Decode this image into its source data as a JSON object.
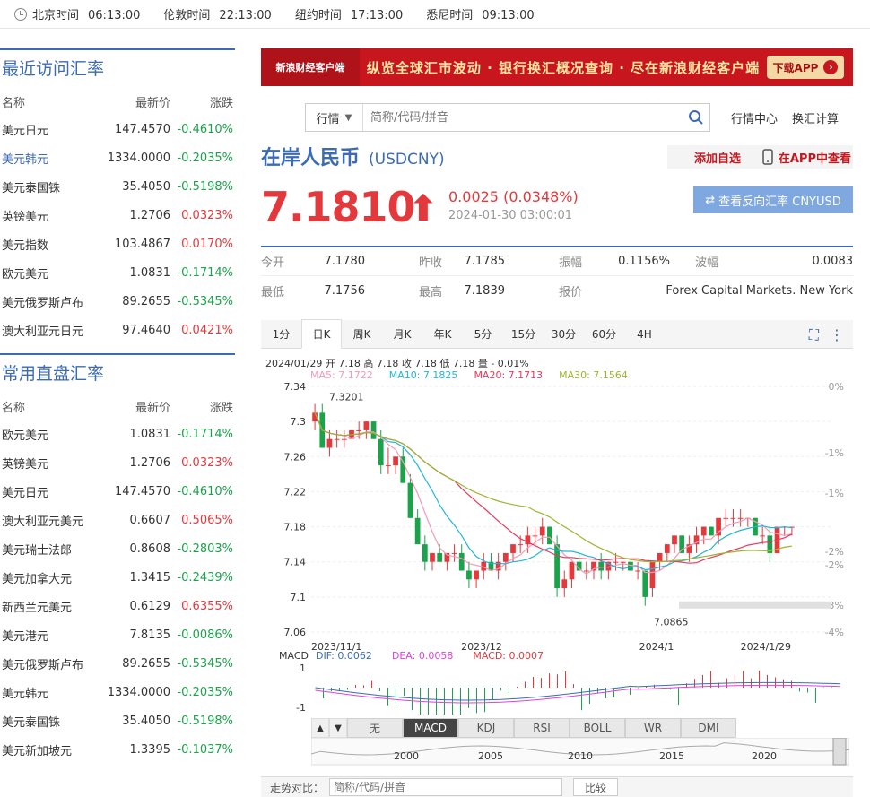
{
  "world_clock": [
    {
      "city": "北京时间",
      "time": "06:13:00"
    },
    {
      "city": "伦敦时间",
      "time": "22:13:00"
    },
    {
      "city": "纽约时间",
      "time": "17:13:00"
    },
    {
      "city": "悉尼时间",
      "time": "09:13:00"
    }
  ],
  "recent": {
    "title": "最近访问汇率",
    "headers": [
      "名称",
      "最新价",
      "涨跌"
    ],
    "rows": [
      {
        "name": "美元日元",
        "price": "147.4570",
        "chg": "-0.4610%",
        "dir": "dn"
      },
      {
        "name": "美元韩元",
        "price": "1334.0000",
        "chg": "-0.2035%",
        "dir": "dn",
        "link": true
      },
      {
        "name": "美元泰国铢",
        "price": "35.4050",
        "chg": "-0.5198%",
        "dir": "dn"
      },
      {
        "name": "英镑美元",
        "price": "1.2706",
        "chg": "0.0323%",
        "dir": "up"
      },
      {
        "name": "美元指数",
        "price": "103.4867",
        "chg": "0.0170%",
        "dir": "up"
      },
      {
        "name": "欧元美元",
        "price": "1.0831",
        "chg": "-0.1714%",
        "dir": "dn"
      },
      {
        "name": "美元俄罗斯卢布",
        "price": "89.2655",
        "chg": "-0.5345%",
        "dir": "dn"
      },
      {
        "name": "澳大利亚元日元",
        "price": "97.4640",
        "chg": "0.0421%",
        "dir": "up"
      }
    ]
  },
  "common": {
    "title": "常用直盘汇率",
    "headers": [
      "名称",
      "最新价",
      "涨跌"
    ],
    "rows": [
      {
        "name": "欧元美元",
        "price": "1.0831",
        "chg": "-0.1714%",
        "dir": "dn"
      },
      {
        "name": "英镑美元",
        "price": "1.2706",
        "chg": "0.0323%",
        "dir": "up"
      },
      {
        "name": "美元日元",
        "price": "147.4570",
        "chg": "-0.4610%",
        "dir": "dn"
      },
      {
        "name": "澳大利亚元美元",
        "price": "0.6607",
        "chg": "0.5065%",
        "dir": "up"
      },
      {
        "name": "美元瑞士法郎",
        "price": "0.8608",
        "chg": "-0.2803%",
        "dir": "dn"
      },
      {
        "name": "美元加拿大元",
        "price": "1.3415",
        "chg": "-0.2439%",
        "dir": "dn"
      },
      {
        "name": "新西兰元美元",
        "price": "0.6129",
        "chg": "0.6355%",
        "dir": "up"
      },
      {
        "name": "美元港元",
        "price": "7.8135",
        "chg": "-0.0086%",
        "dir": "dn"
      },
      {
        "name": "美元俄罗斯卢布",
        "price": "89.2655",
        "chg": "-0.5345%",
        "dir": "dn"
      },
      {
        "name": "美元韩元",
        "price": "1334.0000",
        "chg": "-0.2035%",
        "dir": "dn"
      },
      {
        "name": "美元泰国铢",
        "price": "35.4050",
        "chg": "-0.5198%",
        "dir": "dn"
      },
      {
        "name": "美元新加坡元",
        "price": "1.3395",
        "chg": "-0.1037%",
        "dir": "dn"
      }
    ]
  },
  "banner": {
    "logo": "新浪财经客户端",
    "slogan": "纵览全球汇市波动 · 银行换汇概况查询 · 尽在新浪财经客户端",
    "download": "下载APP"
  },
  "search": {
    "select": "行情",
    "placeholder": "简称/代码/拼音"
  },
  "toplinks": [
    "行情中心",
    "换汇计算"
  ],
  "header": {
    "name": "在岸人民币",
    "code": "(USDCNY)",
    "add": "添加自选",
    "app": "在APP中查看"
  },
  "quote": {
    "price": "7.1810",
    "change": "0.0025 (0.0348%)",
    "timestamp": "2024-01-30 03:00:01",
    "reverse": "查看反向汇率 CNYUSD"
  },
  "stats": [
    [
      {
        "l": "今开",
        "v": "7.1780"
      },
      {
        "l": "昨收",
        "v": "7.1785"
      },
      {
        "l": "振幅",
        "v": "0.1156%"
      },
      {
        "l": "波幅",
        "v": "0.0083"
      }
    ],
    [
      {
        "l": "最低",
        "v": "7.1756"
      },
      {
        "l": "最高",
        "v": "7.1839"
      },
      {
        "l": "报价",
        "v": "Forex Capital Markets. New York"
      }
    ]
  ],
  "tabs": [
    "1分",
    "日K",
    "周K",
    "月K",
    "年K",
    "5分",
    "15分",
    "30分",
    "60分",
    "4H"
  ],
  "active_tab": "日K",
  "kline_info": "2024/01/29 开 7.18 高 7.18 收 7.18 低 7.18 量 - 0.01%",
  "ma": [
    {
      "t": "MA5: 7.1722",
      "c": "#f39bb5"
    },
    {
      "t": "MA10: 7.1825",
      "c": "#21b6d8"
    },
    {
      "t": "MA20: 7.1713",
      "c": "#e4395e"
    },
    {
      "t": "MA30: 7.1564",
      "c": "#9bb630"
    }
  ],
  "macd_info": [
    {
      "t": "MACD",
      "c": "#333"
    },
    {
      "t": "DIF: 0.0062",
      "c": "#3b6bb5"
    },
    {
      "t": "DEA: 0.0058",
      "c": "#e040e0"
    },
    {
      "t": "MACD: 0.0007",
      "c": "#e4393c"
    }
  ],
  "indicators": [
    "无",
    "MACD",
    "KDJ",
    "RSI",
    "BOLL",
    "WR",
    "DMI"
  ],
  "active_indicator": "MACD",
  "compare": {
    "label": "走势对比：",
    "placeholder": "简称/代码/拼音",
    "button": "比较"
  },
  "chart_data": {
    "type": "candlestick",
    "y_ticks": [
      "7.34",
      "7.3",
      "7.26",
      "7.22",
      "7.18",
      "7.14",
      "7.1",
      "7.06"
    ],
    "y_right": [
      "0%",
      "-1%",
      "-1%",
      "-2%",
      "-2%",
      "-3%",
      "-4%"
    ],
    "x_labels": [
      "2023/11/1",
      "2023/12",
      "2024/1",
      "2024/1/29"
    ],
    "high_label": "7.3201",
    "low_label": "7.0865",
    "macd_y": [
      "1",
      "-1"
    ],
    "history_years": [
      "2000",
      "2005",
      "2010",
      "2015",
      "2020"
    ],
    "candles": [
      [
        7.3,
        7.32,
        7.29,
        7.31
      ],
      [
        7.31,
        7.32,
        7.27,
        7.27
      ],
      [
        7.27,
        7.29,
        7.26,
        7.28
      ],
      [
        7.28,
        7.29,
        7.27,
        7.28
      ],
      [
        7.28,
        7.29,
        7.27,
        7.28
      ],
      [
        7.28,
        7.29,
        7.28,
        7.29
      ],
      [
        7.29,
        7.3,
        7.28,
        7.29
      ],
      [
        7.29,
        7.3,
        7.28,
        7.3
      ],
      [
        7.3,
        7.3,
        7.28,
        7.28
      ],
      [
        7.28,
        7.29,
        7.24,
        7.25
      ],
      [
        7.25,
        7.27,
        7.24,
        7.25
      ],
      [
        7.25,
        7.26,
        7.24,
        7.26
      ],
      [
        7.26,
        7.27,
        7.23,
        7.23
      ],
      [
        7.23,
        7.24,
        7.19,
        7.19
      ],
      [
        7.19,
        7.2,
        7.16,
        7.16
      ],
      [
        7.16,
        7.17,
        7.13,
        7.14
      ],
      [
        7.14,
        7.15,
        7.13,
        7.15
      ],
      [
        7.15,
        7.16,
        7.14,
        7.14
      ],
      [
        7.14,
        7.15,
        7.13,
        7.15
      ],
      [
        7.15,
        7.16,
        7.14,
        7.15
      ],
      [
        7.15,
        7.16,
        7.13,
        7.13
      ],
      [
        7.13,
        7.14,
        7.11,
        7.12
      ],
      [
        7.12,
        7.13,
        7.11,
        7.13
      ],
      [
        7.13,
        7.15,
        7.12,
        7.14
      ],
      [
        7.14,
        7.15,
        7.13,
        7.13
      ],
      [
        7.13,
        7.15,
        7.12,
        7.14
      ],
      [
        7.14,
        7.15,
        7.13,
        7.15
      ],
      [
        7.15,
        7.16,
        7.14,
        7.16
      ],
      [
        7.16,
        7.17,
        7.15,
        7.16
      ],
      [
        7.16,
        7.18,
        7.15,
        7.17
      ],
      [
        7.17,
        7.18,
        7.16,
        7.17
      ],
      [
        7.17,
        7.19,
        7.16,
        7.18
      ],
      [
        7.18,
        7.18,
        7.16,
        7.16
      ],
      [
        7.16,
        7.17,
        7.1,
        7.11
      ],
      [
        7.11,
        7.13,
        7.1,
        7.12
      ],
      [
        7.12,
        7.14,
        7.11,
        7.14
      ],
      [
        7.14,
        7.15,
        7.13,
        7.13
      ],
      [
        7.13,
        7.14,
        7.12,
        7.13
      ],
      [
        7.13,
        7.14,
        7.12,
        7.14
      ],
      [
        7.14,
        7.15,
        7.12,
        7.13
      ],
      [
        7.13,
        7.14,
        7.12,
        7.14
      ],
      [
        7.14,
        7.15,
        7.13,
        7.14
      ],
      [
        7.14,
        7.14,
        7.13,
        7.14
      ],
      [
        7.14,
        7.14,
        7.13,
        7.13
      ],
      [
        7.13,
        7.14,
        7.12,
        7.13
      ],
      [
        7.13,
        7.13,
        7.09,
        7.1
      ],
      [
        7.11,
        7.14,
        7.1,
        7.14
      ],
      [
        7.14,
        7.15,
        7.13,
        7.15
      ],
      [
        7.15,
        7.16,
        7.14,
        7.16
      ],
      [
        7.16,
        7.17,
        7.15,
        7.17
      ],
      [
        7.17,
        7.17,
        7.15,
        7.15
      ],
      [
        7.15,
        7.17,
        7.14,
        7.16
      ],
      [
        7.16,
        7.18,
        7.15,
        7.17
      ],
      [
        7.17,
        7.18,
        7.16,
        7.18
      ],
      [
        7.18,
        7.18,
        7.17,
        7.17
      ],
      [
        7.17,
        7.19,
        7.16,
        7.19
      ],
      [
        7.19,
        7.2,
        7.18,
        7.19
      ],
      [
        7.19,
        7.2,
        7.18,
        7.19
      ],
      [
        7.19,
        7.2,
        7.18,
        7.19
      ],
      [
        7.19,
        7.19,
        7.18,
        7.19
      ],
      [
        7.19,
        7.19,
        7.17,
        7.17
      ],
      [
        7.17,
        7.18,
        7.16,
        7.17
      ],
      [
        7.17,
        7.18,
        7.14,
        7.15
      ],
      [
        7.15,
        7.18,
        7.15,
        7.18
      ],
      [
        7.18,
        7.18,
        7.17,
        7.18
      ],
      [
        7.18,
        7.18,
        7.17,
        7.18
      ]
    ]
  }
}
